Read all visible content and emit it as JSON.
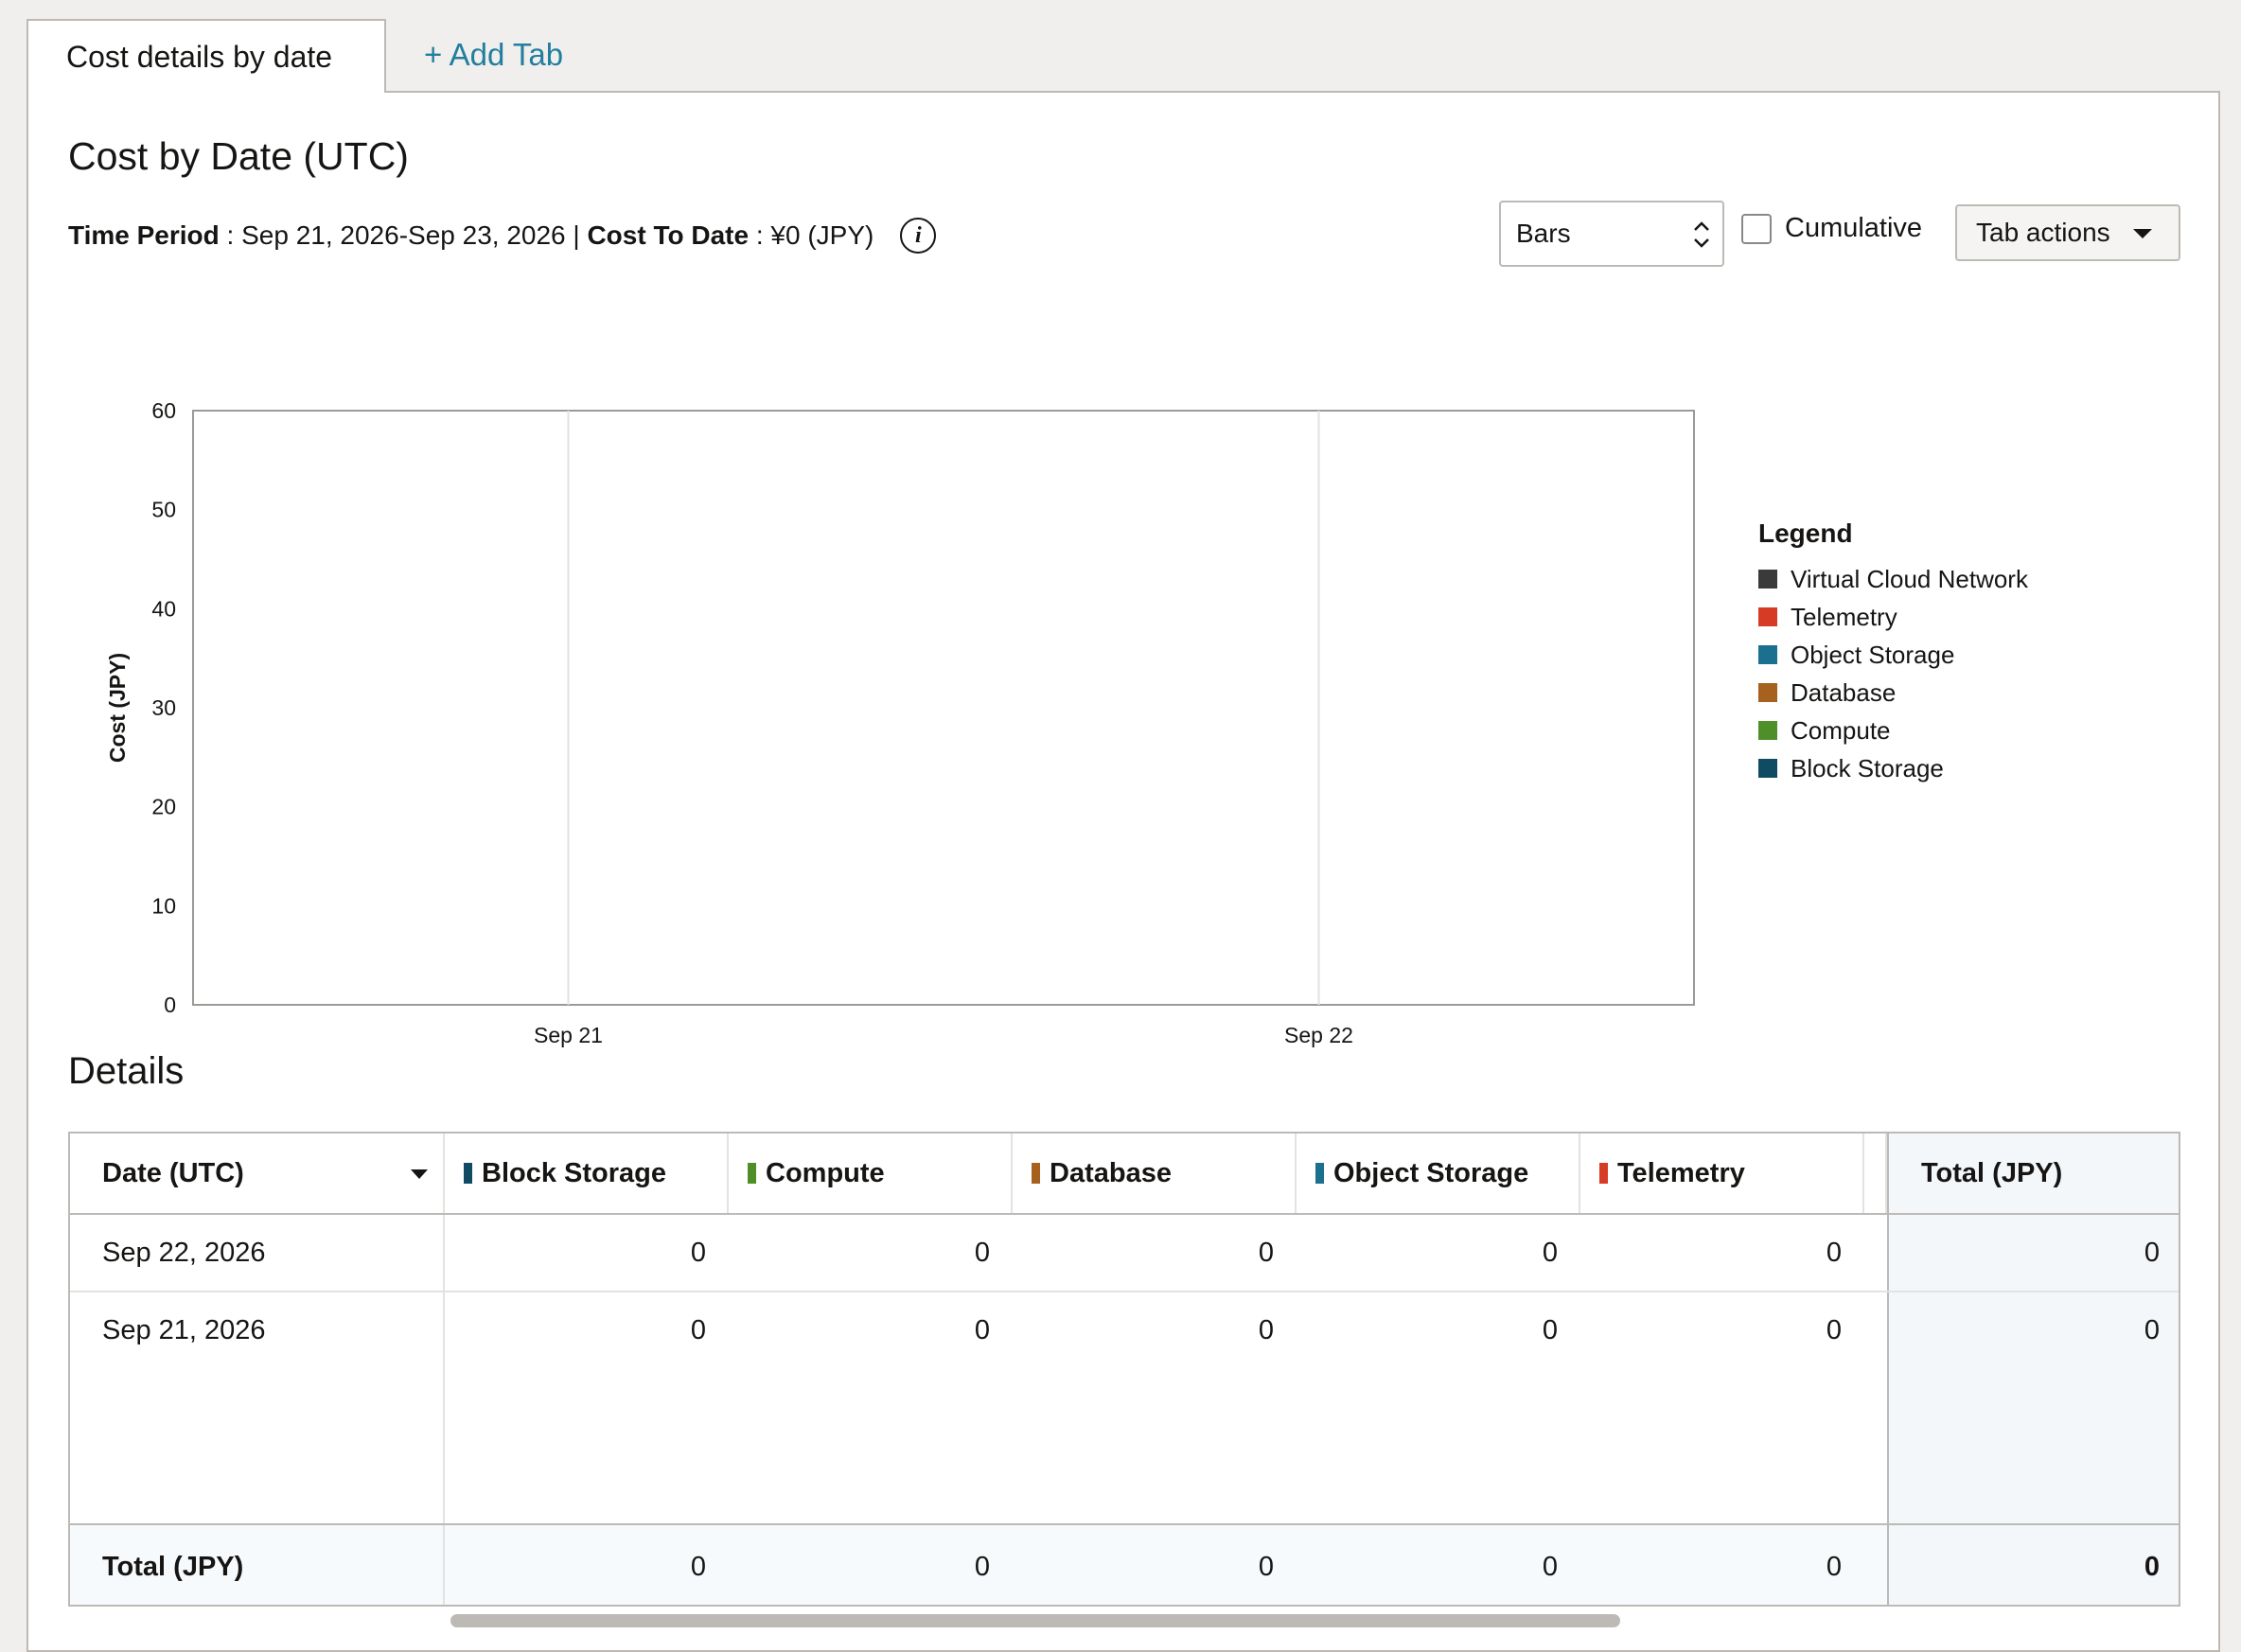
{
  "tabs": {
    "active": "Cost details by date",
    "add": "+ Add Tab"
  },
  "header": {
    "title": "Cost by Date (UTC)",
    "time_period_label": "Time Period",
    "time_period_value": " : Sep 21, 2026-Sep 23, 2026 | ",
    "cost_to_date_label": "Cost To Date",
    "cost_to_date_value": " : ¥0 (JPY)",
    "info_icon": "info-icon"
  },
  "controls": {
    "chart_type_value": "Bars",
    "cumulative_label": "Cumulative",
    "cumulative_checked": false,
    "tab_actions_label": "Tab actions"
  },
  "chart_data": {
    "type": "bar",
    "categories": [
      "Sep 21",
      "Sep 22"
    ],
    "series": [
      {
        "name": "Virtual Cloud Network",
        "color": "#3a3a3a",
        "values": [
          0,
          0
        ]
      },
      {
        "name": "Telemetry",
        "color": "#d63b25",
        "values": [
          0,
          0
        ]
      },
      {
        "name": "Object Storage",
        "color": "#1b6f8f",
        "values": [
          0,
          0
        ]
      },
      {
        "name": "Database",
        "color": "#a5611d",
        "values": [
          0,
          0
        ]
      },
      {
        "name": "Compute",
        "color": "#4f8f2a",
        "values": [
          0,
          0
        ]
      },
      {
        "name": "Block Storage",
        "color": "#0f4c63",
        "values": [
          0,
          0
        ]
      }
    ],
    "xlabel": "Date (UTC)",
    "ylabel": "Cost (JPY)",
    "ylim": [
      0,
      60
    ],
    "yticks": [
      0,
      10,
      20,
      30,
      40,
      50,
      60
    ],
    "legend_title": "Legend",
    "legend_position": "right",
    "grid": true
  },
  "details": {
    "title": "Details",
    "columns": [
      {
        "label": "Date (UTC)",
        "color": null
      },
      {
        "label": "Block Storage",
        "color": "#0f4c63"
      },
      {
        "label": "Compute",
        "color": "#4f8f2a"
      },
      {
        "label": "Database",
        "color": "#a5611d"
      },
      {
        "label": "Object Storage",
        "color": "#1b6f8f"
      },
      {
        "label": "Telemetry",
        "color": "#d63b25"
      },
      {
        "label": "",
        "color": "#3a3a3a"
      },
      {
        "label": "Total (JPY)",
        "color": null
      }
    ],
    "rows": [
      {
        "date": "Sep 22, 2026",
        "values": [
          "0",
          "0",
          "0",
          "0",
          "0"
        ],
        "total": "0"
      },
      {
        "date": "Sep 21, 2026",
        "values": [
          "0",
          "0",
          "0",
          "0",
          "0"
        ],
        "total": "0"
      }
    ],
    "totals": {
      "label": "Total (JPY)",
      "values": [
        "0",
        "0",
        "0",
        "0",
        "0"
      ],
      "total": "0"
    }
  }
}
